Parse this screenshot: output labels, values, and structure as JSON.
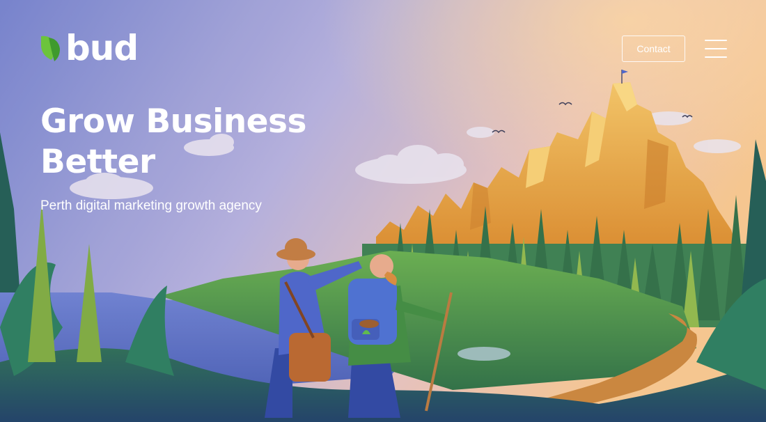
{
  "header": {
    "logo_text": "bud",
    "logo_icon": "leaf-icon",
    "contact_label": "Contact",
    "menu_icon": "hamburger-menu-icon"
  },
  "hero": {
    "title": "Grow Business Better",
    "subtitle": "Perth digital marketing growth agency"
  },
  "colors": {
    "sky_top": "#7b86cc",
    "sky_warm": "#f3c89a",
    "mountain": "#e8a53c",
    "forest_dark": "#24524a",
    "grass": "#58a44a",
    "path": "#c9843a",
    "lake": "#6477c4",
    "logo_green": "#5fbf3a",
    "text": "#ffffff"
  }
}
